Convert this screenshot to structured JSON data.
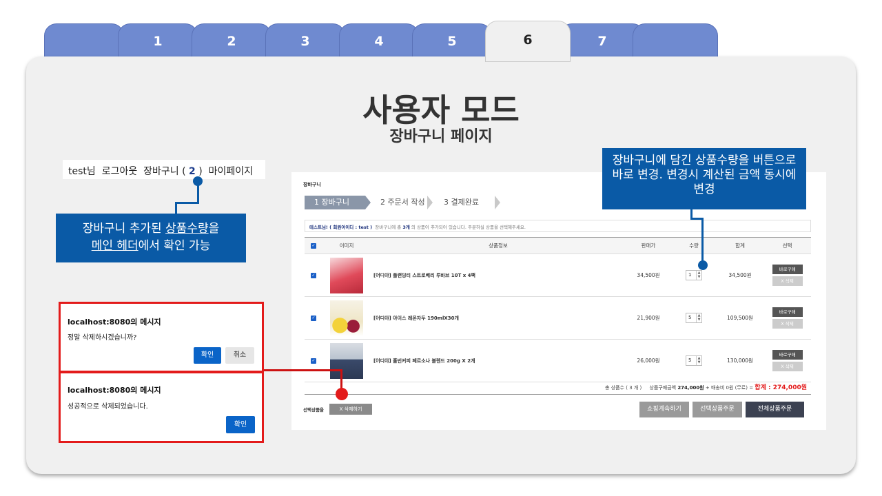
{
  "tabs": [
    "",
    "1",
    "2",
    "3",
    "4",
    "5",
    "6",
    "7",
    ""
  ],
  "active_tab": "6",
  "heading": {
    "title": "사용자 모드",
    "subtitle": "장바구니 페이지"
  },
  "header_bar": {
    "greeting": "test님",
    "logout": "로그아웃",
    "cart_label": "장바구니 (",
    "cart_count": "2",
    "cart_close": ")",
    "mypage": "마이페이지"
  },
  "callout_left": {
    "line1_pre": "장바구니 추가된 ",
    "line1_link": "상품수량",
    "line1_post": "을",
    "line2_link": "메인 헤더",
    "line2_post": "에서 확인 가능"
  },
  "callout_right": {
    "text": "장바구니에 담긴 상품수량을 버튼으로 바로 변경. 변경시 계산된 금액 동시에 변경"
  },
  "dialog_confirm": {
    "title": "localhost:8080의 메시지",
    "message": "정말 삭제하시겠습니까?",
    "ok": "확인",
    "cancel": "취소"
  },
  "dialog_done": {
    "title": "localhost:8080의 메시지",
    "message": "성공적으로 삭제되었습니다.",
    "ok": "확인"
  },
  "cart": {
    "title": "장바구니",
    "steps": [
      "1 장바구니",
      "2 주문서 작성",
      "3 결제완료"
    ],
    "info_user": "테스트님! ( 회원아이디 : test )",
    "info_text": "장바구니에 총",
    "info_count": "3개",
    "info_text2": "의 상품이 추가되어 있습니다.   주문하실 상품을 선택해주세요.",
    "columns": {
      "image": "이미지",
      "info": "상품정보",
      "price": "판매가",
      "qty": "수량",
      "sum": "합계",
      "select": "선택"
    },
    "items": [
      {
        "name": "[어디야] 플랜딩티 스트로베리 루바브 10T x 4팩",
        "price": "34,500원",
        "qty": "1",
        "sum": "34,500원",
        "buy": "바로구매",
        "del": "X 삭제"
      },
      {
        "name": "[어디야] 아이스 레몬자두 190mlX30개",
        "price": "21,900원",
        "qty": "5",
        "sum": "109,500원",
        "buy": "바로구매",
        "del": "X 삭제"
      },
      {
        "name": "[어디야] 홀빈커피 페르소나 블렌드 200g X 2개",
        "price": "26,000원",
        "qty": "5",
        "sum": "130,000원",
        "buy": "바로구매",
        "del": "X 삭제"
      }
    ],
    "total_count": "총 상품수 ( 3 개 )",
    "total_label": "상품구매금액",
    "total_amount": "274,000원",
    "shipping": "+ 배송비 0원 (무료) =",
    "grand": "합계 : 274,000원",
    "selected_label": "선택상품을",
    "selected_delete": "X 삭제하기",
    "continue": "쇼핑계속하기",
    "order_selected": "선택상품주문",
    "order_all": "전체상품주문"
  }
}
